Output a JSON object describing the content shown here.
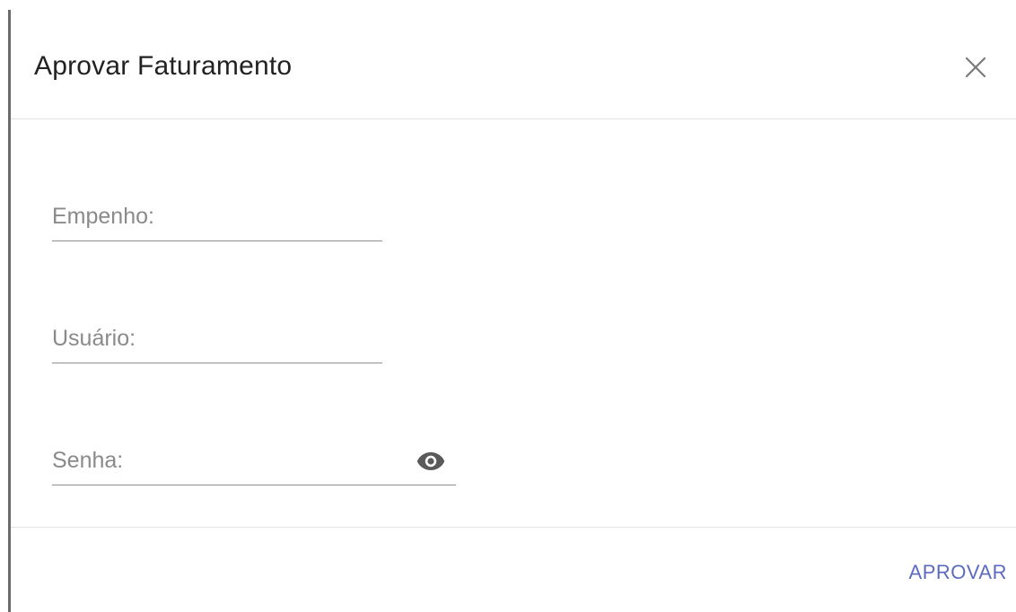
{
  "dialog": {
    "title": "Aprovar Faturamento",
    "close_icon": "close-icon"
  },
  "form": {
    "empenho": {
      "label": "Empenho:",
      "value": ""
    },
    "usuario": {
      "label": "Usuário:",
      "value": ""
    },
    "senha": {
      "label": "Senha:",
      "value": "",
      "toggle_icon": "eye-icon"
    }
  },
  "footer": {
    "approve_label": "APROVAR"
  },
  "colors": {
    "accent": "#5c6bc0",
    "label": "#8a8a8a",
    "divider": "#e3e3e3"
  }
}
